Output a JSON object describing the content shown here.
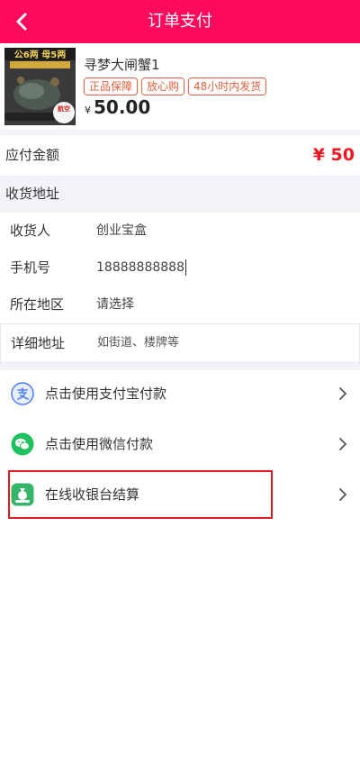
{
  "header": {
    "title": "订单支付",
    "back_icon": "chevron-left-icon",
    "color": "#fe0a5b"
  },
  "product": {
    "image_caption_top": "公6两 母5两",
    "image_badge": "航空",
    "name": "寻梦大闸蟹1",
    "tags": [
      "正品保障",
      "放心购",
      "48小时内发货"
    ],
    "currency_symbol": "¥",
    "price": "50.00"
  },
  "amount": {
    "label": "应付金额",
    "value": "¥ 50",
    "color": "#f0161f"
  },
  "address": {
    "section_title": "收货地址",
    "receiver_label": "收货人",
    "receiver_value": "创业宝盒",
    "phone_label": "手机号",
    "phone_value": "18888888888",
    "region_label": "所在地区",
    "region_value": "请选择",
    "detail_label": "详细地址",
    "detail_placeholder": "如街道、楼牌等"
  },
  "payment_options": [
    {
      "label": "点击使用支付宝付款",
      "icon": "alipay-icon"
    },
    {
      "label": "点击使用微信付款",
      "icon": "wechat-icon"
    },
    {
      "label": "在线收银台结算",
      "icon": "cashier-icon",
      "highlighted": true
    }
  ]
}
